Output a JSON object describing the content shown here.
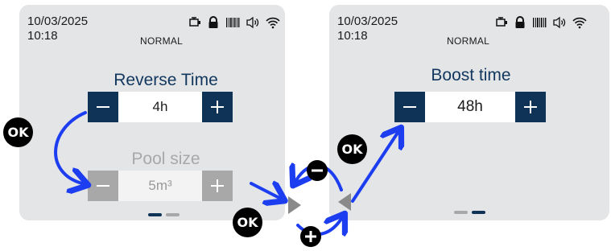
{
  "left_screen": {
    "date": "10/03/2025",
    "time": "10:18",
    "mode": "NORMAL",
    "title_active": "Reverse Time",
    "value_active": "4h",
    "title_inactive": "Pool size",
    "value_inactive": "5m³"
  },
  "right_screen": {
    "date": "10/03/2025",
    "time": "10:18",
    "mode": "NORMAL",
    "title": "Boost time",
    "value": "48h"
  },
  "ok_label": "OK",
  "colors": {
    "accent": "#0e3356",
    "arrow": "#1c3df0",
    "title": "#12375e",
    "inactive": "#a8a8a8"
  },
  "icons": [
    "pump-icon",
    "lock-icon",
    "barcode-icon",
    "speaker-icon",
    "wifi-icon",
    "minus-icon",
    "plus-icon",
    "arrow-icon"
  ]
}
